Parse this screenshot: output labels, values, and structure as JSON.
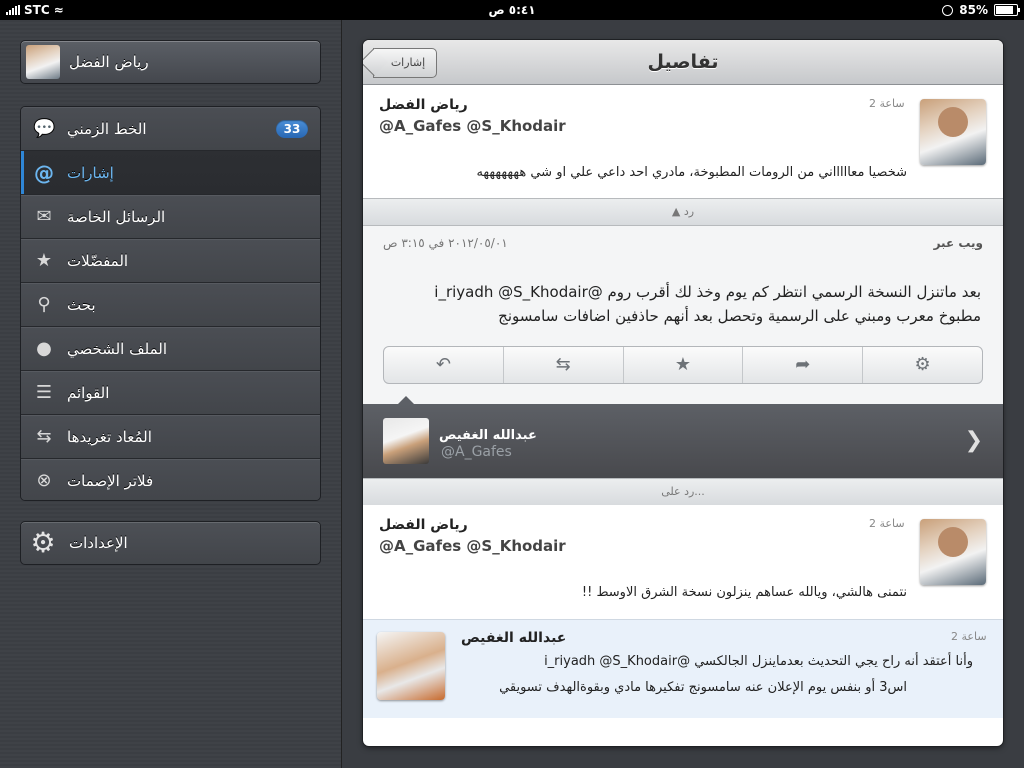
{
  "status": {
    "carrier": "STC",
    "time": "٥:٤١ ص",
    "battery": "85%",
    "battery_level": 0.85
  },
  "sidebar": {
    "profile_name": "رياض الفضل",
    "items": [
      {
        "label": "الخط الزمني",
        "icon": "speech-bubble-icon",
        "badge": "33"
      },
      {
        "label": "إشارات",
        "icon": "at-icon"
      },
      {
        "label": "الرسائل الخاصة",
        "icon": "envelope-icon"
      },
      {
        "label": "المفضّلات",
        "icon": "star-icon"
      },
      {
        "label": "بحث",
        "icon": "search-icon"
      },
      {
        "label": "الملف الشخصي",
        "icon": "person-icon"
      },
      {
        "label": "القوائم",
        "icon": "list-icon"
      },
      {
        "label": "المُعاد تغريدها",
        "icon": "retweet-icon"
      },
      {
        "label": "فلاتر الإصمات",
        "icon": "mute-icon"
      }
    ],
    "settings_label": "الإعدادات"
  },
  "detail": {
    "title": "تفاصيل",
    "back_label": "إشارات",
    "tweet1": {
      "name": "رياض الفضل",
      "time": "2 ساعة",
      "mentions": "@A_Gafes @S_Khodair",
      "text": "شخصيا معاااااني من الرومات المطبوخة، مادري احد داعي علي او شي هههههههه"
    },
    "divider_reply": "رد",
    "main": {
      "source": "ويب عبر",
      "timestamp": "٢٠١٢/٠٥/٠١ في ٣:١٥ ص",
      "text_line1": "بعد ماتنزل النسخة الرسمي انتظر كم يوم وخذ لك أقرب روم @i_riyadh @S_Khodair",
      "text_line2": "مطبوخ معرب ومبني على الرسمية وتحصل بعد أنهم حاذفين اضافات سامسونج"
    },
    "author": {
      "name": "عبدالله الغفيص",
      "handle": "@A_Gafes"
    },
    "divider_reply_to": "رد على...",
    "tweet2": {
      "name": "رياض الفضل",
      "time": "2 ساعة",
      "mentions": "@A_Gafes @S_Khodair",
      "text": "نتمنى هالشي، ويالله عساهم ينزلون نسخة الشرق الاوسط !!"
    },
    "tweet3": {
      "name": "عبدالله الغفيص",
      "time": "2 ساعة",
      "line1": "وأنا أعتقد أنه راح يجي التحديث بعدماينزل الجالكسي @i_riyadh @S_Khodair",
      "line2": "اس3 أو بنفس يوم الإعلان عنه سامسونج تفكيرها مادي وبقوةالهدف تسويقي"
    }
  }
}
